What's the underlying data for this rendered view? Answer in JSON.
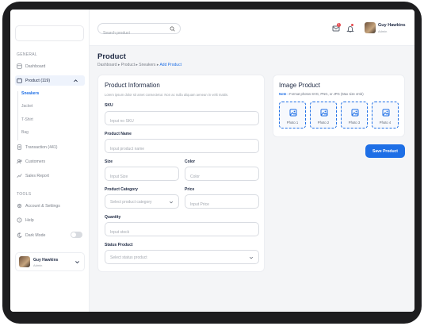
{
  "sidebar": {
    "general_label": "GENERAL",
    "items": [
      {
        "label": "Dashboard"
      },
      {
        "label": "Product (119)"
      },
      {
        "label": "Transaction (441)"
      },
      {
        "label": "Customers"
      },
      {
        "label": "Sales Report"
      }
    ],
    "product_sub": [
      "Sneakers",
      "Jacket",
      "T-Shirt",
      "Bag"
    ],
    "tools_label": "TOOLS",
    "tools": [
      {
        "label": "Account & Settings"
      },
      {
        "label": "Help"
      },
      {
        "label": "Dark Mode"
      }
    ],
    "user": {
      "name": "Guy Hawkins",
      "role": "Admin"
    }
  },
  "topbar": {
    "search_placeholder": "Search product",
    "mail_badge": "1",
    "user": {
      "name": "Guy Hawkins",
      "role": "Admin"
    }
  },
  "page": {
    "title": "Product",
    "breadcrumb": [
      "Dashboard",
      "Product",
      "Sneakers",
      "Add Product"
    ]
  },
  "product_info": {
    "title": "Product Information",
    "subtitle": "Lorem ipsum dolor sit amet consectetur. Non ac nulla aliquam aenean in velit mattis.",
    "sku": {
      "label": "SKU",
      "placeholder": "Input no SKU"
    },
    "name": {
      "label": "Product Name",
      "placeholder": "Input product name"
    },
    "size": {
      "label": "Size",
      "placeholder": "Input Size"
    },
    "color": {
      "label": "Color",
      "placeholder": "Color"
    },
    "category": {
      "label": "Product Category",
      "placeholder": "Select product category"
    },
    "price": {
      "label": "Price",
      "placeholder": "Input Price"
    },
    "quantity": {
      "label": "Quantity",
      "placeholder": "Input stock"
    },
    "status": {
      "label": "Status Product",
      "placeholder": "Select status product"
    }
  },
  "image_product": {
    "title": "Image Product",
    "note_label": "Note :",
    "note": "Format photos SVG, PNG, or JPG (Max size 4mb)",
    "photos": [
      "Photo 1",
      "Photo 2",
      "Photo 3",
      "Photo 4"
    ]
  },
  "save_label": "Save Product",
  "colors": {
    "accent": "#1e6fe6",
    "badge": "#e5484d"
  }
}
